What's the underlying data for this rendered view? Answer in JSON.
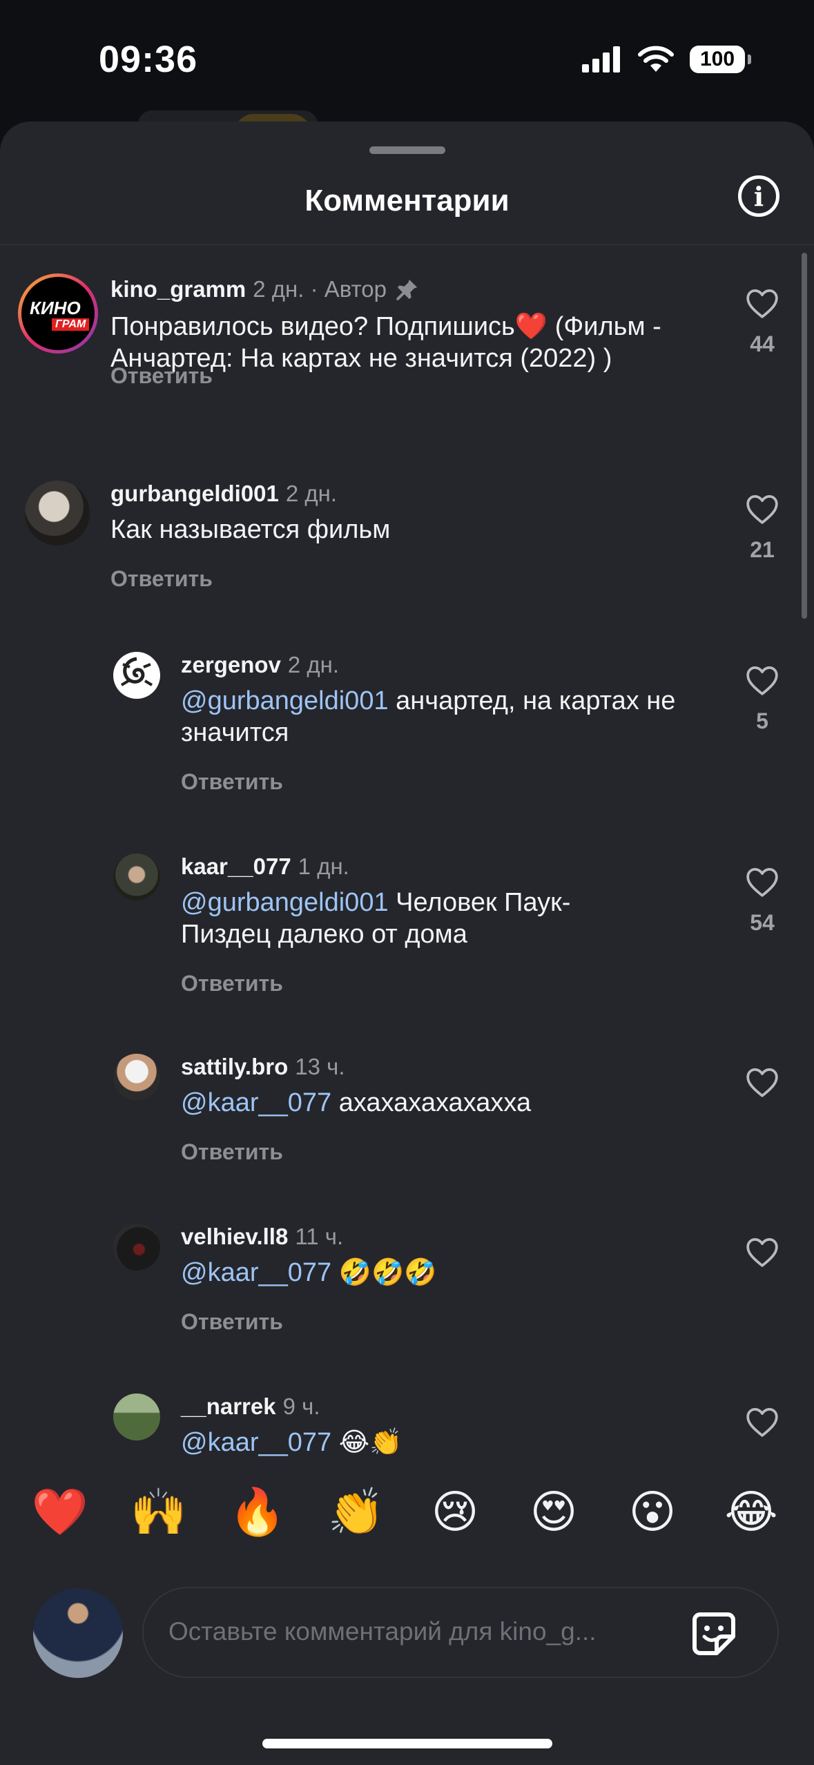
{
  "status_bar": {
    "time": "09:36",
    "battery": "100"
  },
  "sheet": {
    "title": "Комментарии"
  },
  "comments": [
    {
      "username": "kino_gramm",
      "time": "2 дн.",
      "author_label": "· Автор",
      "text": "Понравилось видео? Подпишись❤️  (Фильм - Анчартед: На картах не значится (2022) )",
      "reply": "Ответить",
      "likes": "44",
      "pinned": true
    },
    {
      "username": "gurbangeldi001",
      "time": "2 дн.",
      "text": "Как называется фильм",
      "reply": "Ответить",
      "likes": "21"
    },
    {
      "username": "zergenov",
      "time": "2 дн.",
      "mention": "@gurbangeldi001",
      "text": " анчартед, на картах не значится",
      "reply": "Ответить",
      "likes": "5"
    },
    {
      "username": "kaar__077",
      "time": "1 дн.",
      "mention": "@gurbangeldi001",
      "text": " Человек Паук- Пиздец далеко от дома",
      "reply": "Ответить",
      "likes": "54"
    },
    {
      "username": "sattily.bro",
      "time": "13 ч.",
      "mention": "@kaar__077",
      "text": " ахахахахахахха",
      "reply": "Ответить",
      "likes": ""
    },
    {
      "username": "velhiev.ll8",
      "time": "11 ч.",
      "mention": "@kaar__077",
      "text": " 🤣🤣🤣",
      "reply": "Ответить",
      "likes": ""
    },
    {
      "username": "__narrek",
      "time": "9 ч.",
      "mention": "@kaar__077",
      "text": " 😂👏",
      "reply": "",
      "likes": ""
    }
  ],
  "avatars": {
    "kino_line1": "КИНО",
    "kino_line2": "ГРАМ"
  },
  "emoji_bar": [
    "❤️",
    "🙌",
    "🔥",
    "👏",
    "😢",
    "😍",
    "😮",
    "😂"
  ],
  "composer": {
    "placeholder": "Оставьте комментарий для kino_g..."
  },
  "colors": {
    "sheet_bg": "#25262b",
    "mention": "#9dc4f5",
    "secondary_text": "#9a9ba1"
  }
}
